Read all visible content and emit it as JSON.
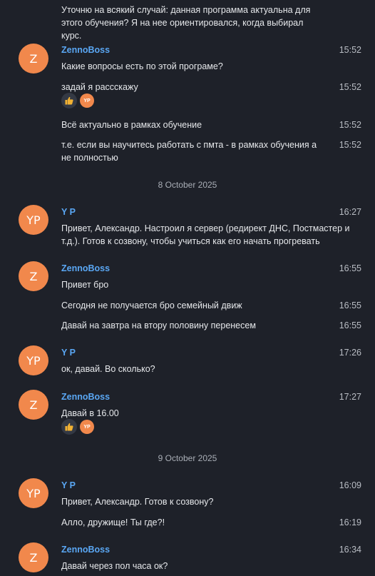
{
  "colors": {
    "background": "#1e2129",
    "name": "#5aa7f4",
    "avatar": "#f1884c",
    "text": "#e6e8eb",
    "time": "#b9bdc4"
  },
  "messages": [
    {
      "text": "Уточню на всякий случай: данная программа актуальна для этого обучения? Я на нее ориентировался, когда выбирал курс."
    },
    {
      "avatar": "Z",
      "name": "ZennoBoss",
      "time": "15:52",
      "text": "Какие вопросы есть по этой програме?"
    },
    {
      "time": "15:52",
      "text": "задай я рассскажу",
      "reaction_user": "YP"
    },
    {
      "time": "15:52",
      "text": "Всё актуально в рамках обучение"
    },
    {
      "time": "15:52",
      "text": "т.е. если вы научитесь работать с пмта - в рамках обучения а не полностью"
    },
    {
      "date": "8 October 2025"
    },
    {
      "avatar": "YP",
      "name": "Y P",
      "time": "16:27",
      "text": "Привет, Александр. Настроил я сервер (редирект ДНС, Постмастер и т.д.). Готов к созвону, чтобы учиться как его начать прогревать"
    },
    {
      "avatar": "Z",
      "name": "ZennoBoss",
      "time": "16:55",
      "text": "Привет бро"
    },
    {
      "time": "16:55",
      "text": "Сегодня не получается бро семейный движ"
    },
    {
      "time": "16:55",
      "text": "Давай на завтра на втору половину перенесем"
    },
    {
      "avatar": "YP",
      "name": "Y P",
      "time": "17:26",
      "text": "ок, давай. Во сколько?"
    },
    {
      "avatar": "Z",
      "name": "ZennoBoss",
      "time": "17:27",
      "text": "Давай в 16.00",
      "reaction_user": "YP"
    },
    {
      "date": "9 October 2025"
    },
    {
      "avatar": "YP",
      "name": "Y P",
      "time": "16:09",
      "text": "Привет, Александр. Готов к созвону?"
    },
    {
      "time": "16:19",
      "text": "Алло, дружище! Ты где?!"
    },
    {
      "avatar": "Z",
      "name": "ZennoBoss",
      "time": "16:34",
      "text": "Давай через пол часа ок?"
    }
  ]
}
